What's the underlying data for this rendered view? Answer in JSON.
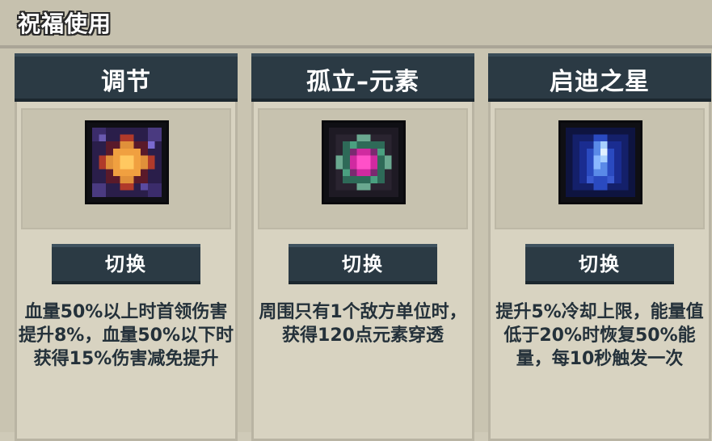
{
  "header": {
    "title": "祝福使用"
  },
  "cards": [
    {
      "title": "调节",
      "icon": "adjust-blessing-icon",
      "button_label": "切换",
      "description": "血量50%以上时首领伤害提升8%，血量50%以下时获得15%伤害减免提升"
    },
    {
      "title": "孤立–元素",
      "icon": "isolated-element-icon",
      "button_label": "切换",
      "description": "周围只有1个敌方单位时，获得120点元素穿透"
    },
    {
      "title": "启迪之星",
      "icon": "enlightenment-star-icon",
      "button_label": "切换",
      "description": "提升5%冷却上限，能量值低于20%时恢复50%能量，每10秒触发一次"
    }
  ],
  "colors": {
    "panel_dark": "#2b3a44",
    "panel_light": "#d8d3c1",
    "text_dark": "#24313a"
  }
}
